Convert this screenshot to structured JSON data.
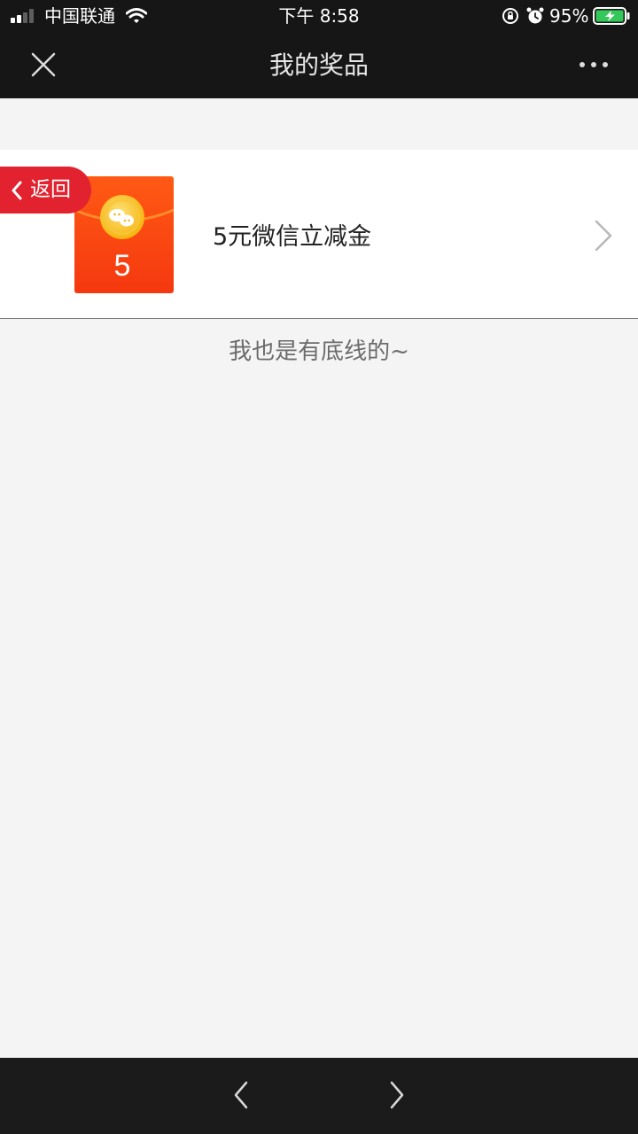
{
  "status_bar": {
    "carrier": "中国联通",
    "time": "下午 8:58",
    "battery_percent": "95%",
    "battery_color": "#34c759",
    "icons": [
      "signal-icon",
      "wifi-icon",
      "orientation-lock-icon",
      "alarm-icon",
      "battery-charging-icon"
    ]
  },
  "nav_bar": {
    "title": "我的奖品",
    "close_icon": "close-icon",
    "more_icon": "more-dots-icon"
  },
  "prize": {
    "envelope_amount": "5",
    "name": "5元微信立减金",
    "envelope_color": "#ff5a14",
    "coin_color": "#ffc21a",
    "chevron_icon": "chevron-right-icon"
  },
  "back_button": {
    "label": "返回",
    "color": "#e2232f",
    "icon": "chevron-left-icon"
  },
  "footer_note": "我也是有底线的~",
  "bottom_bar": {
    "icons": [
      "back-arrow-icon",
      "forward-arrow-icon"
    ]
  }
}
